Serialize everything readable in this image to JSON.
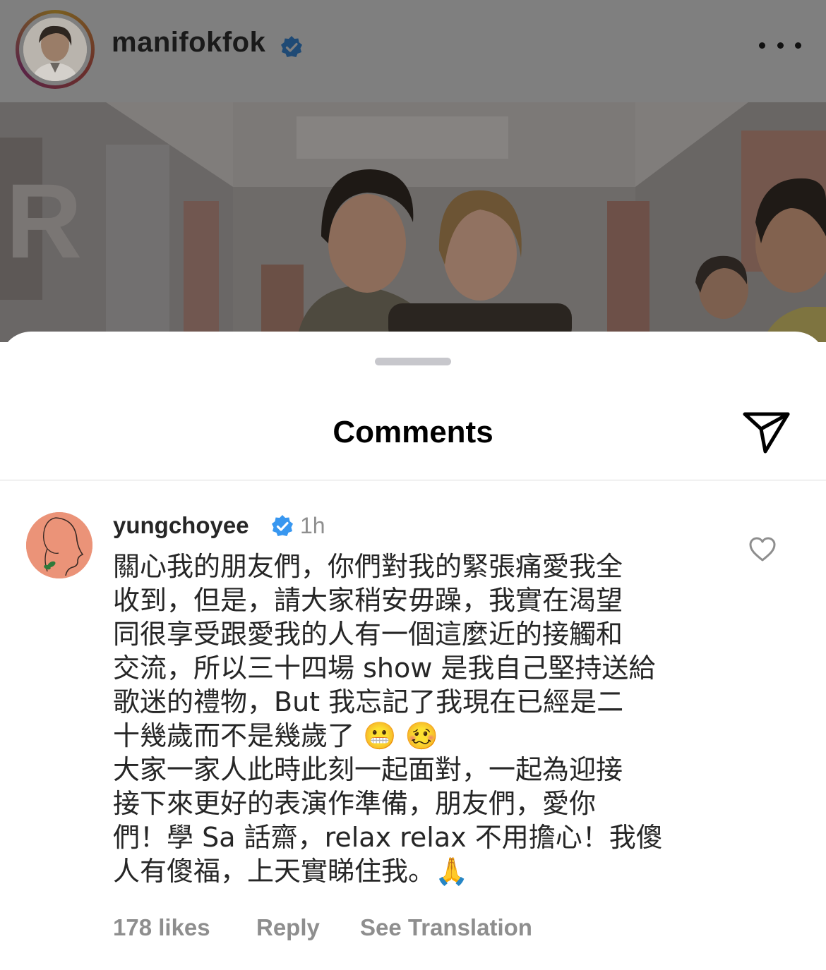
{
  "post": {
    "username": "manifokfok",
    "verified_icon": "verified-badge-icon",
    "more_icon": "more-horizontal-icon"
  },
  "sheet": {
    "title": "Comments",
    "share_icon": "send-icon"
  },
  "comment": {
    "username": "yungchoyee",
    "time": "1h",
    "text": "關心我的朋友們，你們對我的緊張痛愛我全\n收到，但是，請大家稍安毋躁，我實在渴望\n同很享受跟愛我的人有一個這麼近的接觸和\n交流，所以三十四場 show 是我自己堅持送給\n歌迷的禮物，But 我忘記了我現在已經是二\n十幾歲而不是幾歲了 😬 🥴\n大家一家人此時此刻一起面對，一起為迎接\n接下來更好的表演作準備，朋友們，愛你\n們！學 Sa 話齋，relax relax 不用擔心！我傻\n人有傻福，上天實睇住我。🙏",
    "likes": "178 likes",
    "reply_label": "Reply",
    "translation_label": "See Translation",
    "like_icon": "heart-outline-icon"
  },
  "colors": {
    "verified_blue": "#3897f0",
    "secondary_text": "#8e8e8e",
    "dim_overlay": "#7f7f7f"
  }
}
